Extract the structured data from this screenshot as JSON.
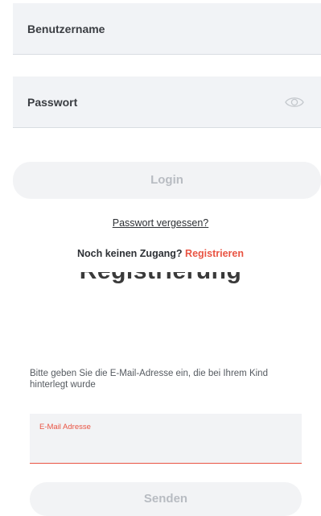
{
  "login": {
    "username_placeholder": "Benutzername",
    "password_placeholder": "Passwort",
    "login_label": "Login",
    "forgot_label": "Passwort vergessen?",
    "no_account_text": "Noch keinen Zugang?",
    "register_label": "Registrieren"
  },
  "registration": {
    "title": "Registrierung",
    "instruction": "Bitte geben Sie die E-Mail-Adresse ein, die bei Ihrem Kind hinterlegt wurde",
    "email_label": "E-Mail Adresse",
    "email_value": "",
    "send_label": "Senden"
  },
  "icons": {
    "password_toggle": "eye-icon"
  },
  "colors": {
    "accent": "#e95443",
    "field_bg": "#f1f3f6",
    "disabled_text": "#b8bcc2"
  }
}
